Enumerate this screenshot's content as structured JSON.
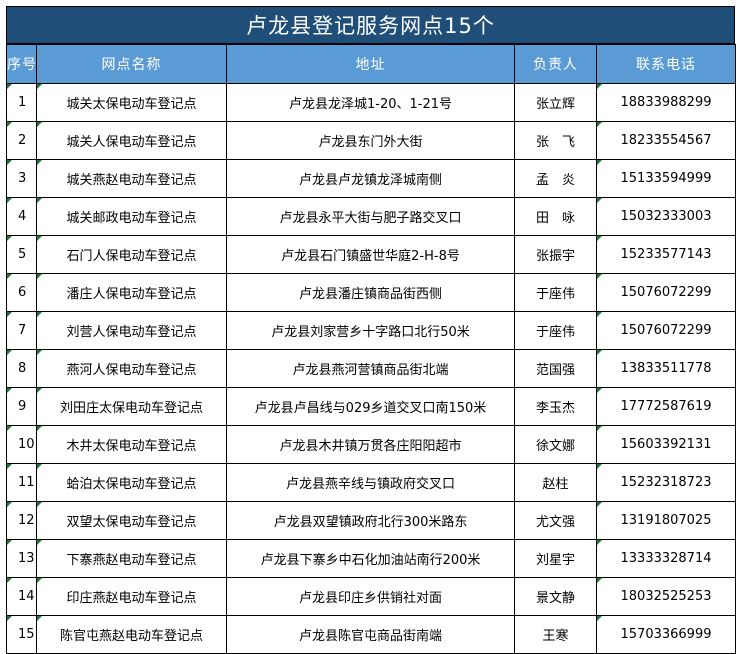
{
  "title": "卢龙县登记服务网点15个",
  "headers": {
    "seq": "序号",
    "name": "网点名称",
    "address": "地址",
    "person": "负责人",
    "phone": "联系电话"
  },
  "rows": [
    {
      "seq": "1",
      "name": "城关太保电动车登记点",
      "address": "卢龙县龙泽城1-20、1-21号",
      "person": "张立辉",
      "phone": "18833988299"
    },
    {
      "seq": "2",
      "name": "城关人保电动车登记点",
      "address": "卢龙县东门外大街",
      "person": "张　飞",
      "phone": "18233554567"
    },
    {
      "seq": "3",
      "name": "城关燕赵电动车登记点",
      "address": "卢龙县卢龙镇龙泽城南侧",
      "person": "孟　炎",
      "phone": "15133594999"
    },
    {
      "seq": "4",
      "name": "城关邮政电动车登记点",
      "address": "卢龙县永平大街与肥子路交叉口",
      "person": "田　咏",
      "phone": "15032333003"
    },
    {
      "seq": "5",
      "name": "石门人保电动车登记点",
      "address": "卢龙县石门镇盛世华庭2-H-8号",
      "person": "张振宇",
      "phone": "15233577143"
    },
    {
      "seq": "6",
      "name": "潘庄人保电动车登记点",
      "address": "卢龙县潘庄镇商品街西侧",
      "person": "于座伟",
      "phone": "15076072299"
    },
    {
      "seq": "7",
      "name": "刘营人保电动车登记点",
      "address": "卢龙县刘家营乡十字路口北行50米",
      "person": "于座伟",
      "phone": "15076072299"
    },
    {
      "seq": "8",
      "name": "燕河人保电动车登记点",
      "address": "卢龙县燕河营镇商品街北端",
      "person": "范国强",
      "phone": "13833511778"
    },
    {
      "seq": "9",
      "name": "刘田庄太保电动车登记点",
      "address": "卢龙县卢昌线与029乡道交叉口南150米",
      "person": "李玉杰",
      "phone": "17772587619"
    },
    {
      "seq": "10",
      "name": "木井太保电动车登记点",
      "address": "卢龙县木井镇万贯各庄阳阳超市",
      "person": "徐文娜",
      "phone": "15603392131"
    },
    {
      "seq": "11",
      "name": "蛤泊太保电动车登记点",
      "address": "卢龙县燕辛线与镇政府交叉口",
      "person": "赵柱",
      "phone": "15232318723"
    },
    {
      "seq": "12",
      "name": "双望太保电动车登记点",
      "address": "卢龙县双望镇政府北行300米路东",
      "person": "尤文强",
      "phone": "13191807025"
    },
    {
      "seq": "13",
      "name": "下寨燕赵电动车登记点",
      "address": "卢龙县下寨乡中石化加油站南行200米",
      "person": "刘星宇",
      "phone": "13333328714"
    },
    {
      "seq": "14",
      "name": "印庄燕赵电动车登记点",
      "address": "卢龙县印庄乡供销社对面",
      "person": "景文静",
      "phone": "18032525253"
    },
    {
      "seq": "15",
      "name": "陈官屯燕赵电动车登记点",
      "address": "卢龙县陈官屯商品街南端",
      "person": "王寒",
      "phone": "15703366999"
    }
  ]
}
